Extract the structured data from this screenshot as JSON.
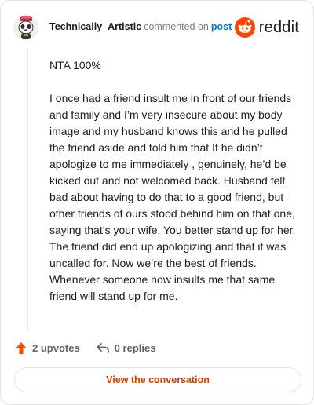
{
  "header": {
    "username": "Technically_Artistic",
    "commented_text": "commented on",
    "post_link": "post",
    "brand": "reddit"
  },
  "comment": {
    "paragraphs": [
      "NTA 100%",
      "I once had a friend insult me in front of our friends and family and I’m very insecure about my body image and my husband knows this and he pulled the friend aside and told him that If he didn’t apologize to me immediately , genuinely, he’d be kicked out and not welcomed back. Husband felt bad about having to do that to a good friend, but other friends of ours stood behind him on that one, saying that’s your wife. You better stand up for her. The friend did end up apologizing and that it was uncalled for. Now we’re the best of friends. Whenever someone now insults me that same friend will stand up for me."
    ]
  },
  "actions": {
    "upvotes": "2 upvotes",
    "replies": "0 replies"
  },
  "footer": {
    "view_button": "View the conversation"
  },
  "colors": {
    "brand_orange": "#ff4500",
    "upvote_orange": "#ff4500",
    "link_blue": "#0079d3",
    "button_text": "#d93a00"
  },
  "icons": {
    "avatar": "snoo-avatar-icon",
    "logo": "reddit-logo-icon",
    "upvote": "upvote-arrow-icon",
    "reply": "reply-arrow-icon"
  }
}
